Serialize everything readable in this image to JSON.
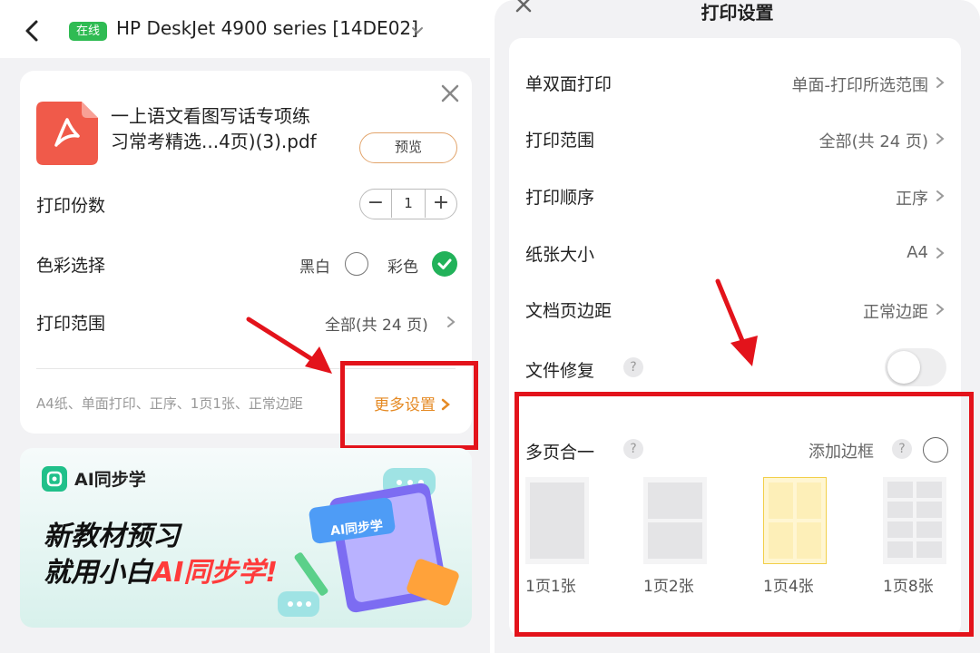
{
  "left": {
    "header": {
      "online_badge": "在线",
      "printer_name": "HP DeskJet 4900 series [14DE02]"
    },
    "file": {
      "name_line1": "一上语文看图写话专项练",
      "name_line2": "习常考精选...4页)(3).pdf",
      "preview_label": "预览"
    },
    "copies": {
      "label": "打印份数",
      "value": "1",
      "minus": "−",
      "plus": "+"
    },
    "color": {
      "label": "色彩选择",
      "bw_label": "黑白",
      "color_label": "彩色",
      "selected": "彩色"
    },
    "range": {
      "label": "打印范围",
      "value": "全部(共 24 页)"
    },
    "summary": "A4纸、单面打印、正序、1页1张、正常边距",
    "more_settings": "更多设置",
    "banner": {
      "app_name": "AI同步学",
      "slogan_line1": "新教材预习",
      "slogan_line2_prefix": "就用小白",
      "slogan_line2_highlight": "AI同步学!",
      "art_label": "AI同步学"
    }
  },
  "right": {
    "title": "打印设置",
    "rows": [
      {
        "label": "单双面打印",
        "value": "单面-打印所选范围"
      },
      {
        "label": "打印范围",
        "value": "全部(共 24 页)"
      },
      {
        "label": "打印顺序",
        "value": "正序"
      },
      {
        "label": "纸张大小",
        "value": "A4"
      },
      {
        "label": "文档页边距",
        "value": "正常边距"
      }
    ],
    "repair": {
      "label": "文件修复",
      "help": "?",
      "enabled": false
    },
    "multipage": {
      "label": "多页合一",
      "help": "?",
      "border_label": "添加边框",
      "border_help": "?",
      "options": [
        {
          "label": "1页1张"
        },
        {
          "label": "1页2张"
        },
        {
          "label": "1页4张"
        },
        {
          "label": "1页8张"
        }
      ],
      "selected": "1页4张"
    }
  },
  "colors": {
    "accent_orange": "#e58a24",
    "success_green": "#22b25a",
    "annotation_red": "#e3131b",
    "pdf_red": "#f05a4a"
  }
}
